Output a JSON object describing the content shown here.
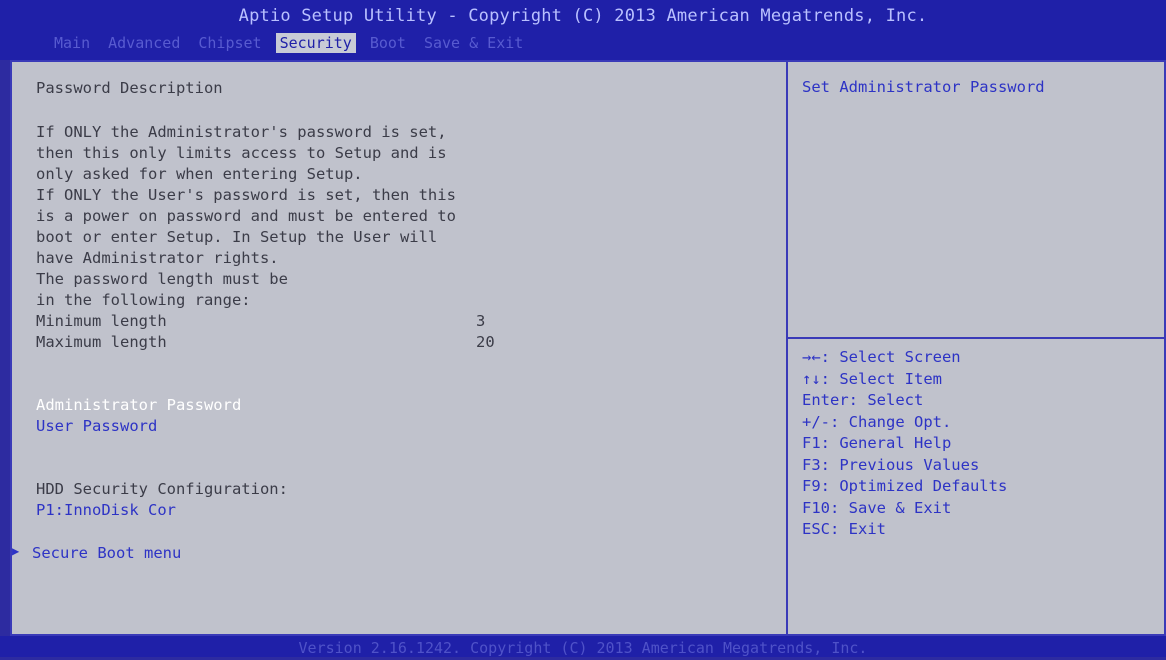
{
  "header": {
    "title": "Aptio Setup Utility - Copyright (C) 2013 American Megatrends, Inc.",
    "tabs": [
      "Main",
      "Advanced",
      "Chipset",
      "Security",
      "Boot",
      "Save & Exit"
    ],
    "active_tab": "Security"
  },
  "left": {
    "description_title": "Password Description",
    "description_lines": [
      "If ONLY the Administrator's password is set,",
      "then this only limits access to Setup and is",
      "only asked for when entering Setup.",
      "If ONLY the User's password is set, then this",
      "is a power on password and must be entered to",
      "boot or enter Setup. In Setup the User will",
      "have Administrator rights.",
      "The password length must be",
      "in the following range:"
    ],
    "min_label": "Minimum length",
    "min_value": "3",
    "max_label": "Maximum length",
    "max_value": "20",
    "admin_password": "Administrator Password",
    "user_password": "User Password",
    "hdd_label": "HDD Security Configuration:",
    "hdd_item": "P1:InnoDisk Cor",
    "secure_boot": "Secure Boot menu"
  },
  "right": {
    "help_text": "Set Administrator Password",
    "keys": [
      "→←: Select Screen",
      "↑↓: Select Item",
      "Enter: Select",
      "+/-: Change Opt.",
      "F1: General Help",
      "F3: Previous Values",
      "F9: Optimized Defaults",
      "F10: Save & Exit",
      "ESC: Exit"
    ]
  },
  "footer": {
    "text": "Version 2.16.1242. Copyright (C) 2013 American Megatrends, Inc."
  },
  "colors": {
    "frame": "#2d2ba0",
    "panel": "#c0c2cc",
    "link": "#2d33c5",
    "text": "#3b3c48",
    "selected": "#ffffff"
  }
}
